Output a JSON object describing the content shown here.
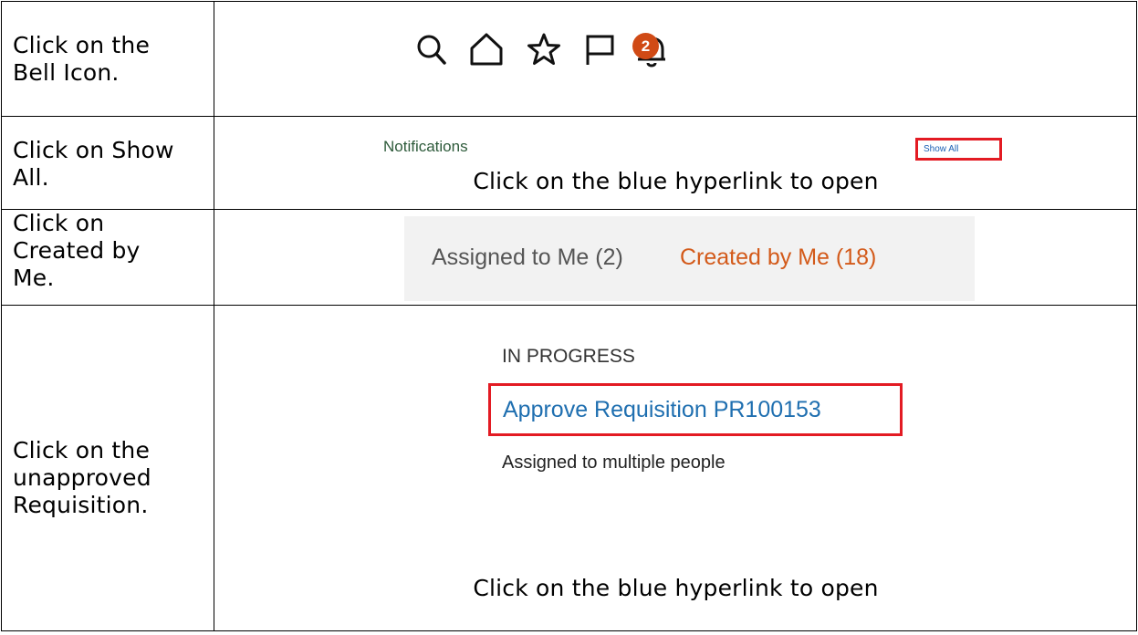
{
  "steps": [
    {
      "instruction": "Click on the\nBell Icon."
    },
    {
      "instruction": "Click on Show\nAll."
    },
    {
      "instruction": "Click on\nCreated by\nMe."
    },
    {
      "instruction": "Click on the\nunapproved\nRequisition."
    }
  ],
  "toolbar": {
    "icons": [
      "search-icon",
      "home-icon",
      "star-icon",
      "flag-icon",
      "bell-icon"
    ],
    "notification_count": "2",
    "badge_color": "#d04a15"
  },
  "notifications": {
    "title": "Notifications",
    "show_all_label": "Show All",
    "caption": "Click on the blue hyperlink to open"
  },
  "tabs": {
    "assigned": "Assigned to Me (2)",
    "created": "Created by Me (18)",
    "active_color": "#d35a1a"
  },
  "requisition": {
    "status": "IN PROGRESS",
    "link_label": "Approve Requisition PR100153",
    "assignment": "Assigned to multiple people",
    "caption": "Click on the blue hyperlink to open"
  },
  "highlight_color": "#e31b23"
}
